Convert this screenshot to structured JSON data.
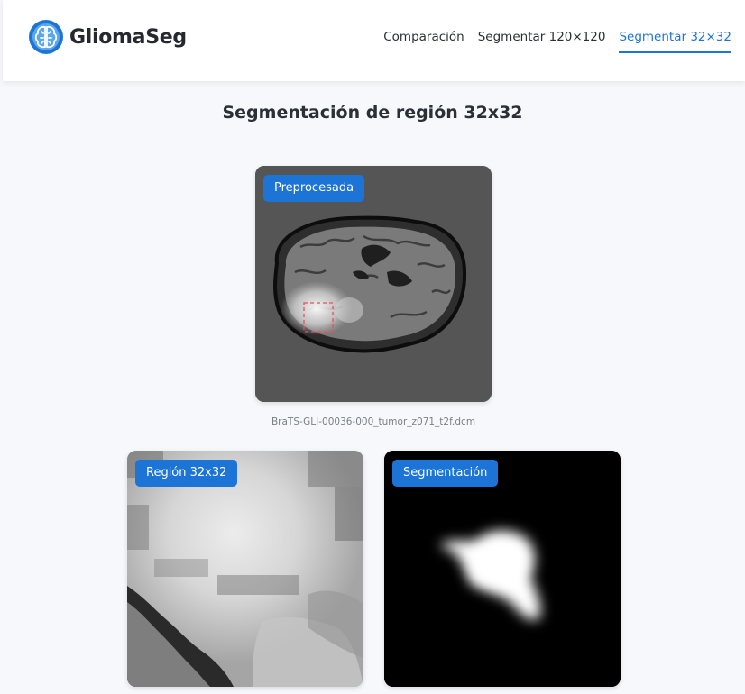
{
  "app": {
    "name": "GliomaSeg",
    "logo_icon": "brain-icon"
  },
  "nav": {
    "items": [
      {
        "label": "Comparación",
        "active": false
      },
      {
        "label": "Segmentar 120×120",
        "active": false
      },
      {
        "label": "Segmentar 32×32",
        "active": true
      }
    ]
  },
  "page": {
    "title": "Segmentación de región 32x32"
  },
  "images": {
    "preprocessed": {
      "badge": "Preprocesada",
      "filename": "BraTS-GLI-00036-000_tumor_z071_t2f.dcm"
    },
    "region": {
      "badge": "Región 32x32"
    },
    "segmentation": {
      "badge": "Segmentación"
    }
  },
  "colors": {
    "accent": "#1b74d6",
    "roi_box": "#e8505b"
  }
}
